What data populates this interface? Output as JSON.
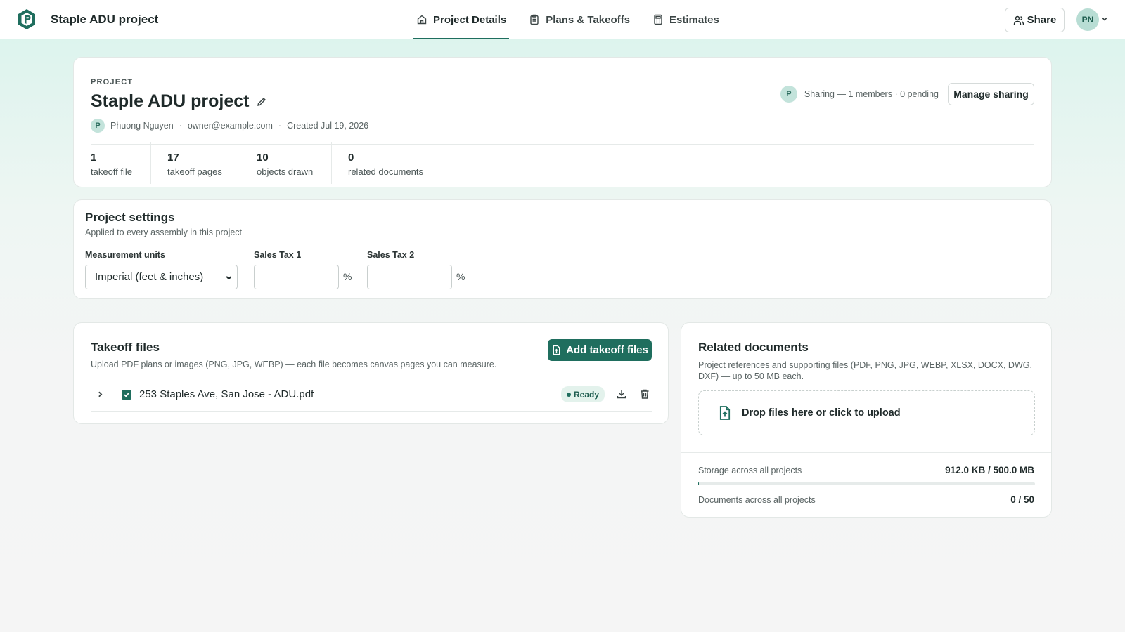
{
  "app": {
    "title": "Staple ADU project"
  },
  "nav": {
    "tabs": [
      {
        "label": "Project Details",
        "icon": "home-icon",
        "active": true
      },
      {
        "label": "Plans & Takeoffs",
        "icon": "clipboard-icon",
        "active": false
      },
      {
        "label": "Estimates",
        "icon": "calculator-icon",
        "active": false
      }
    ],
    "share_label": "Share",
    "user_initials": "PN"
  },
  "project": {
    "eyebrow": "PROJECT",
    "name": "Staple ADU project",
    "owner_initial": "P",
    "owner_name": "Phuong Nguyen",
    "owner_email": "owner@example.com",
    "created": "Created Jul 19, 2026",
    "sharing_initial": "P",
    "sharing_text": "Sharing — 1 members · 0 pending",
    "manage_sharing_label": "Manage sharing",
    "stats": [
      {
        "value": "1",
        "label": "takeoff file"
      },
      {
        "value": "17",
        "label": "takeoff pages"
      },
      {
        "value": "10",
        "label": "objects drawn"
      },
      {
        "value": "0",
        "label": "related documents"
      }
    ]
  },
  "settings": {
    "title": "Project settings",
    "subtitle": "Applied to every assembly in this project",
    "units_label": "Measurement units",
    "units_value": "Imperial (feet & inches)",
    "tax1_label": "Sales Tax 1",
    "tax1_value": "",
    "tax2_label": "Sales Tax 2",
    "tax2_value": "",
    "percent_symbol": "%"
  },
  "takeoff": {
    "title": "Takeoff files",
    "subtitle": "Upload PDF plans or images (PNG, JPG, WEBP) — each file becomes canvas pages you can measure.",
    "add_label": "Add takeoff files",
    "files": [
      {
        "name": "253 Staples Ave, San Jose - ADU.pdf",
        "status": "Ready",
        "checked": true
      }
    ]
  },
  "related": {
    "title": "Related documents",
    "subtitle": "Project references and supporting files (PDF, PNG, JPG, WEBP, XLSX, DOCX, DWG, DXF) — up to 50 MB each.",
    "dropzone_label": "Drop files here or click to upload",
    "storage_label": "Storage across all projects",
    "storage_value": "912.0 KB / 500.0 MB",
    "storage_fraction": 0.0018,
    "documents_label": "Documents across all projects",
    "documents_value": "0 / 50"
  },
  "colors": {
    "accent": "#1f6e5e",
    "avatar_bg": "#b8ddd4",
    "badge_bg": "#e3f2ec"
  }
}
